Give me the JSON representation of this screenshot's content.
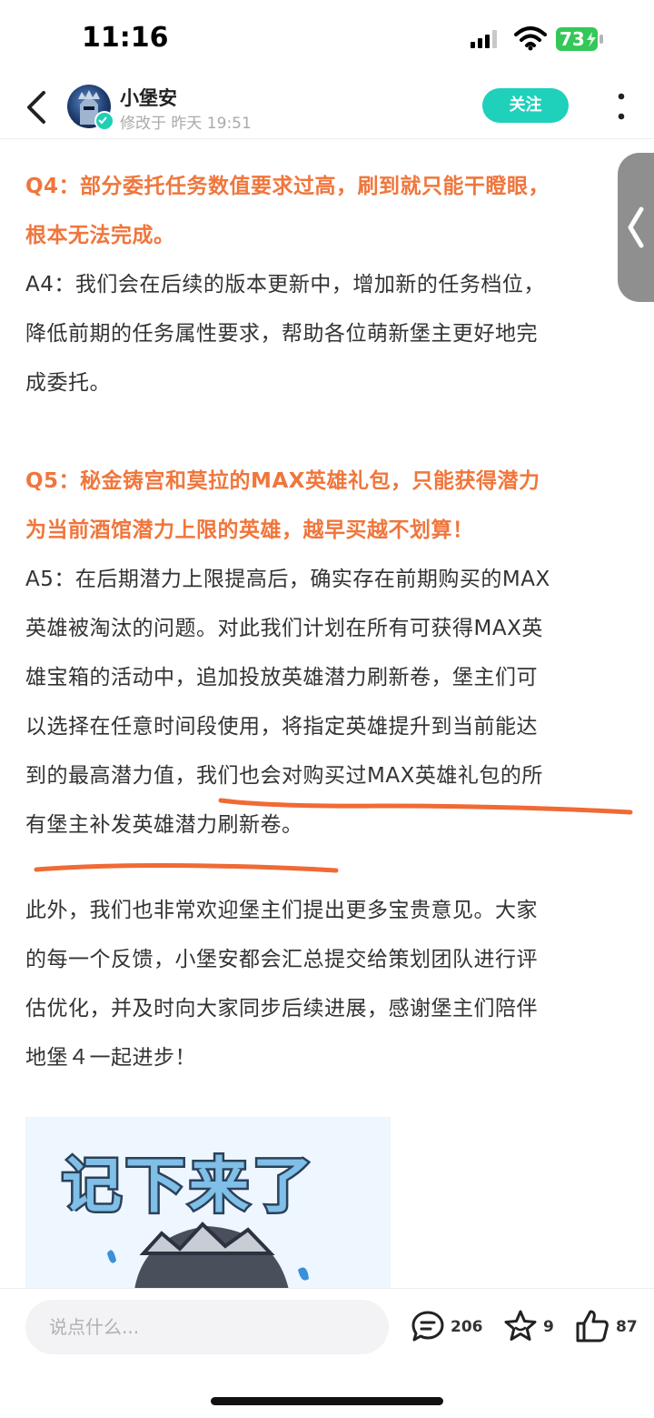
{
  "status_bar": {
    "time": "11:16",
    "battery": "73"
  },
  "header": {
    "author": "小堡安",
    "modified": "修改于 昨天 19:51",
    "follow_label": "关注"
  },
  "content": {
    "q4_line1": "Q4：部分委托任务数值要求过高，刷到就只能干瞪眼，",
    "q4_line2": "根本无法完成。",
    "a4_line1": "A4：我们会在后续的版本更新中，增加新的任务档位，",
    "a4_line2": "降低前期的任务属性要求，帮助各位萌新堡主更好地完",
    "a4_line3": "成委托。",
    "q5_line1": "Q5：秘金铸宫和莫拉的MAX英雄礼包，只能获得潜力",
    "q5_line2": "为当前酒馆潜力上限的英雄，越早买越不划算！",
    "a5_line1": "A5：在后期潜力上限提高后，确实存在前期购买的MAX",
    "a5_line2": "英雄被淘汰的问题。对此我们计划在所有可获得MAX英",
    "a5_line3": "雄宝箱的活动中，追加投放英雄潜力刷新卷，堡主们可",
    "a5_line4": "以选择在任意时间段使用，将指定英雄提升到当前能达",
    "a5_line5": "到的最高潜力值，我们也会对购买过MAX英雄礼包的所",
    "a5_line6": "有堡主补发英雄潜力刷新卷。",
    "outro_line1": "此外，我们也非常欢迎堡主们提出更多宝贵意见。大家",
    "outro_line2": "的每一个反馈，小堡安都会汇总提交给策划团队进行评",
    "outro_line3": "估优化，并及时向大家同步后续进展，感谢堡主们陪伴",
    "outro_line4": "地堡４一起进步！",
    "sticker_text": "记下来了"
  },
  "bottom_bar": {
    "comment_placeholder": "说点什么...",
    "comments_count": "206",
    "favorites_count": "9",
    "likes_count": "87"
  },
  "colors": {
    "accent": "#1fd0bb",
    "question": "#f0763c",
    "annotation": "#f06a35"
  }
}
